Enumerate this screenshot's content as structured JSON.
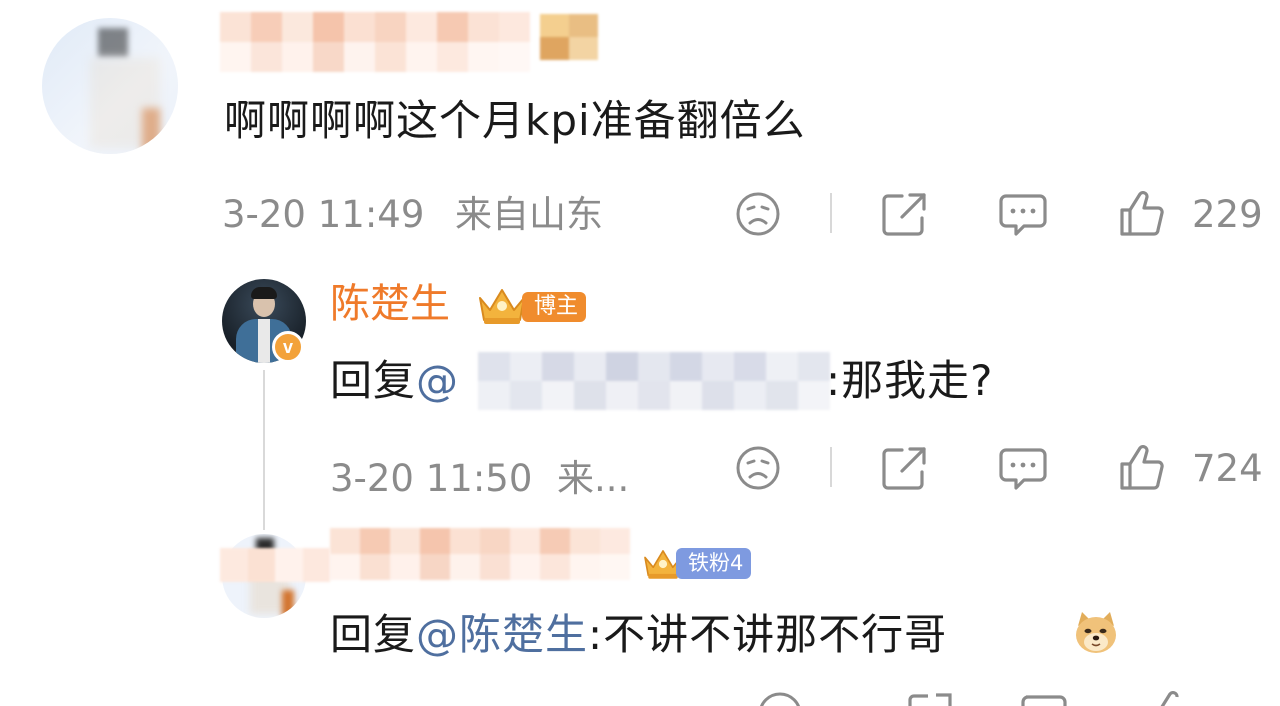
{
  "comments": [
    {
      "text": "啊啊啊啊这个月kpi准备翻倍么",
      "time": "3-20 11:49",
      "location": "来自山东",
      "like_count": "229"
    }
  ],
  "replies": [
    {
      "username": "陈楚生",
      "role_badge": "博主",
      "prefix": "回复",
      "mention": "@",
      "suffix": ":那我走?",
      "time": "3-20 11:50",
      "location": "来...",
      "like_count": "724"
    },
    {
      "fan_badge": "铁粉4",
      "prefix": "回复",
      "mention": "@陈楚生",
      "suffix": ":不讲不讲那不行哥"
    }
  ],
  "icons": {
    "dislike": "sad-face-icon",
    "share": "share-icon",
    "comment": "comment-bubble-icon",
    "like": "thumbs-up-icon",
    "verified": "verified-v-icon",
    "crown": "crown-icon",
    "doge": "doge-emoji-icon"
  },
  "colors": {
    "accent_orange": "#ef7a2a",
    "mention_blue": "#4f6f9f",
    "meta_gray": "#8b8b8b"
  }
}
